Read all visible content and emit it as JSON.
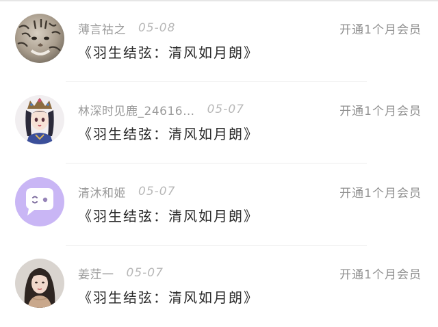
{
  "comments": [
    {
      "username": "薄言祜之",
      "date": "05-08",
      "content": "《羽生结弦：清风如月朗》",
      "membership": "开通1个月会员",
      "avatar_icon": "tiger-cub-avatar"
    },
    {
      "username": "林深时见鹿_24616…",
      "date": "05-07",
      "content": "《羽生结弦：清风如月朗》",
      "membership": "开通1个月会员",
      "avatar_icon": "anime-princess-avatar"
    },
    {
      "username": "清沐和姬",
      "date": "05-07",
      "content": "《羽生结弦：清风如月朗》",
      "membership": "开通1个月会员",
      "avatar_icon": "chat-bubble-avatar"
    },
    {
      "username": "姜茳一",
      "date": "05-07",
      "content": "《羽生结弦：清风如月朗》",
      "membership": "开通1个月会员",
      "avatar_icon": "woman-portrait-avatar"
    }
  ],
  "colors": {
    "username": "#9a9a9a",
    "content": "#2a2a2a",
    "accent_purple": "#c9b6f5"
  }
}
